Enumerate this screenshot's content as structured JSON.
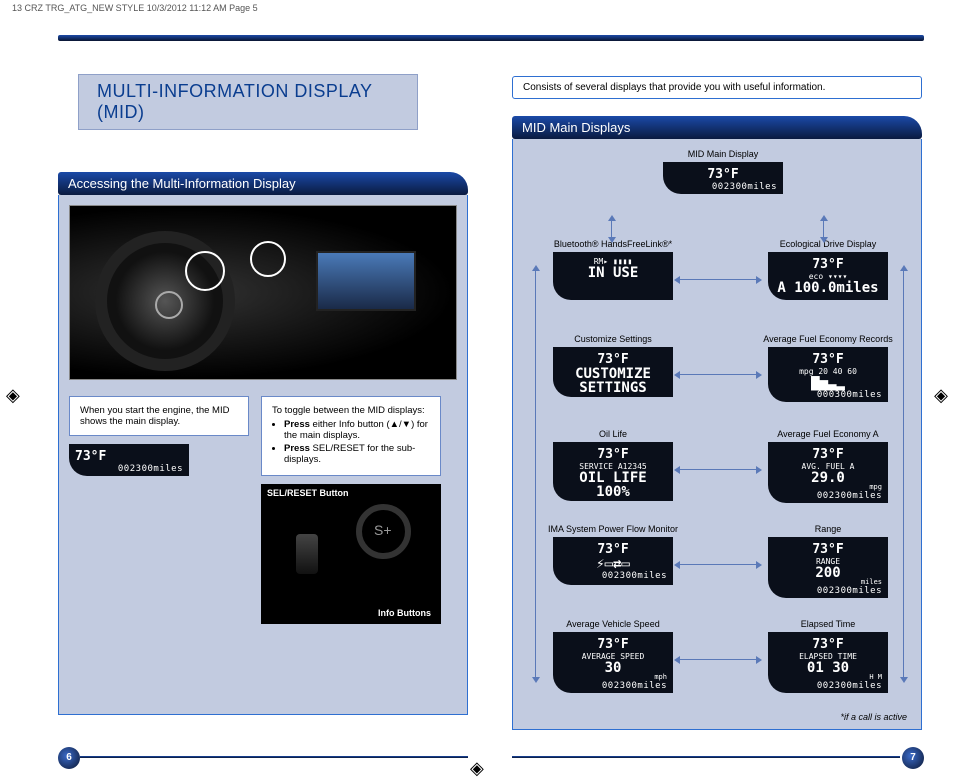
{
  "meta": {
    "header": "13 CRZ TRG_ATG_NEW STYLE  10/3/2012  11:12 AM  Page 5"
  },
  "title": "MULTI-INFORMATION DISPLAY (MID)",
  "top_info": "Consists of several displays that provide you with useful information.",
  "left": {
    "section_title": "Accessing the Multi-Information Display",
    "start_text": "When you start the engine, the MID shows the main display.",
    "start_temp": "73°F",
    "start_odo": "002300miles",
    "toggle_intro": "To toggle between the MID displays:",
    "toggle_b1a": "Press",
    "toggle_b1b": " either Info button (▲/▼) for the main displays.",
    "toggle_b2a": "Press",
    "toggle_b2b": " SEL/RESET for the sub-displays.",
    "sel_label": "SEL/RESET Button",
    "info_label": "Info Buttons"
  },
  "right": {
    "section_title": "MID Main Displays",
    "footnote": "*if a call is active",
    "top_item": {
      "caption": "MID Main Display",
      "temp": "73°F",
      "odo": "002300miles"
    },
    "left_col": [
      {
        "caption": "Bluetooth® HandsFreeLink®*",
        "line1": "RM▸    ▮▮▮▮",
        "big": "IN USE",
        "odo": ""
      },
      {
        "caption": "Customize Settings",
        "temp": "73°F",
        "big": "CUSTOMIZE SETTINGS",
        "odo": ""
      },
      {
        "caption": "Oil Life",
        "temp": "73°F",
        "line1": "SERVICE  A12345",
        "big": "OIL LIFE 100%",
        "odo": ""
      },
      {
        "caption": "IMA System Power Flow Monitor",
        "temp": "73°F",
        "big": "⚡▭⇄▭",
        "odo": "002300miles"
      },
      {
        "caption": "Average Vehicle Speed",
        "temp": "73°F",
        "line1": "AVERAGE SPEED",
        "big": "30",
        "unit": "mph",
        "odo": "002300miles"
      }
    ],
    "right_col": [
      {
        "caption": "Ecological Drive Display",
        "temp": "73°F",
        "line1": "eco ▾▾▾▾",
        "big": "A  100.0miles",
        "odo": ""
      },
      {
        "caption": "Average Fuel Economy Records",
        "temp": "73°F",
        "line1": "mpg 20 40 60",
        "big": "▇▅▃▂",
        "odo": "000300miles"
      },
      {
        "caption": "Average Fuel Economy A",
        "temp": "73°F",
        "line1": "AVG. FUEL A",
        "big": "29.0",
        "unit": "mpg",
        "odo": "002300miles"
      },
      {
        "caption": "Range",
        "temp": "73°F",
        "line1": "RANGE",
        "big": "200",
        "unit": "miles",
        "odo": "002300miles"
      },
      {
        "caption": "Elapsed Time",
        "temp": "73°F",
        "line1": "ELAPSED TIME",
        "big": "01 30",
        "unit": "H    M",
        "odo": "002300miles"
      }
    ]
  },
  "page_numbers": {
    "left": "6",
    "right": "7"
  }
}
